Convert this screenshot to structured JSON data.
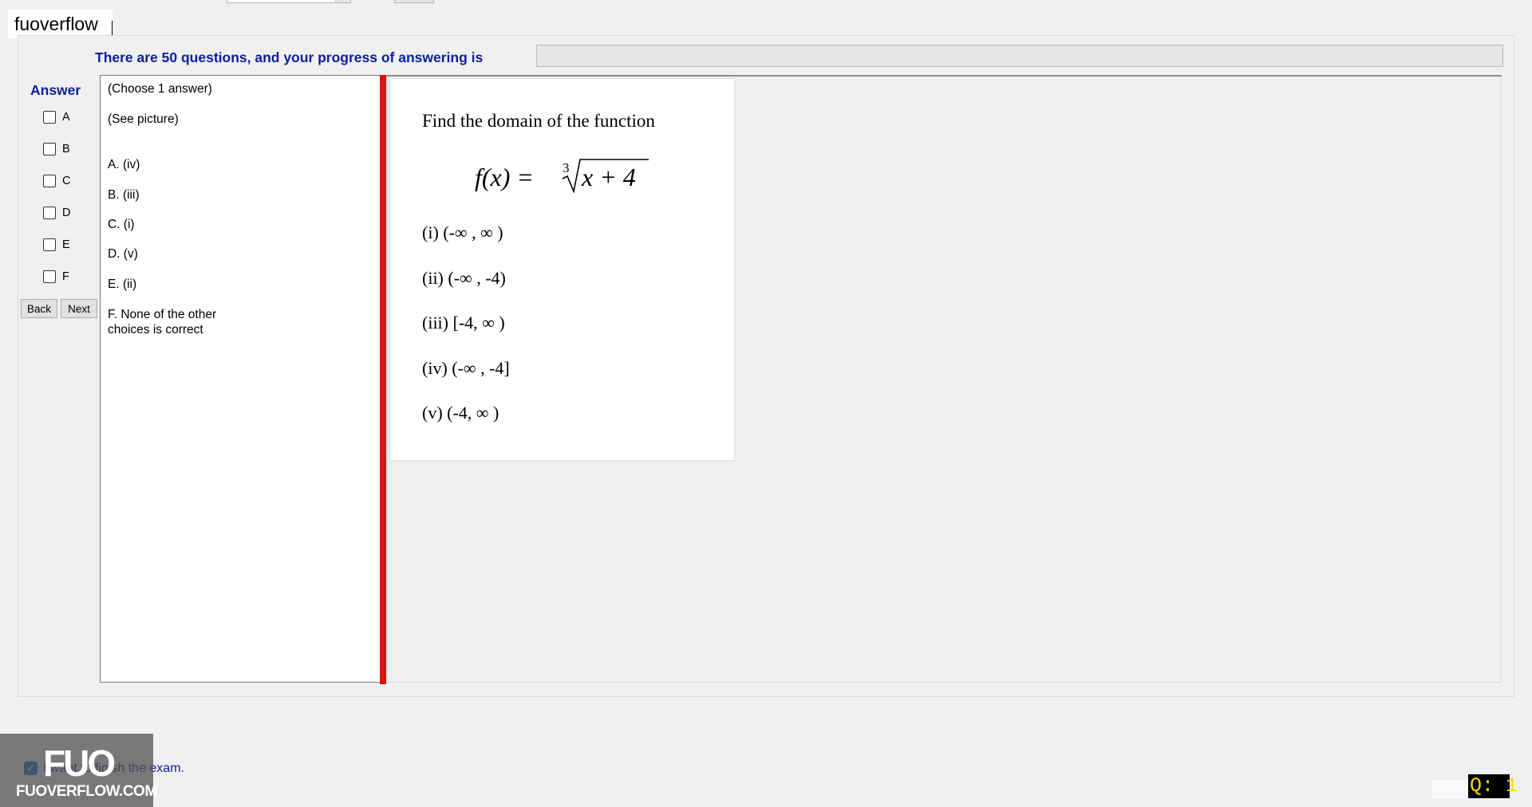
{
  "brand": {
    "label": "fuoverflow"
  },
  "header": {
    "progress_text": "There are 50 questions, and your progress of answering is",
    "progress_percent": 0
  },
  "answer_panel": {
    "title": "Answer",
    "options": [
      "A",
      "B",
      "C",
      "D",
      "E",
      "F"
    ],
    "back_label": "Back",
    "next_label": "Next"
  },
  "answers_text": {
    "instruction": "(Choose 1 answer)",
    "see_picture": "(See picture)",
    "choices": [
      "A. (iv)",
      "B. (iii)",
      "C. (i)",
      "D. (v)",
      "E. (ii)"
    ],
    "choice_f_line1": "F.  None of the other",
    "choice_f_line2": "choices is correct"
  },
  "question": {
    "prompt": "Find the domain of the function",
    "formula": {
      "lhs": "f(x) =",
      "index": "3",
      "radicand": "x + 4"
    },
    "choices": [
      "(i) (-∞ , ∞ )",
      "(ii) (-∞ , -4)",
      "(iii) [-4, ∞ )",
      "(iv) (-∞ , -4]",
      "(v) (-4, ∞ )"
    ]
  },
  "footer": {
    "finish_text": "I want to finish the exam.",
    "finish_checked": true,
    "watermark_letters": "FUO",
    "watermark_site": "FUOVERFLOW.COM",
    "question_badge": "Q: 1"
  },
  "colors": {
    "accent_blue": "#0a1fa0",
    "timer_blue": "#1c1cd2",
    "splitter_red": "#e01010",
    "badge_yellow": "#ffd800"
  }
}
